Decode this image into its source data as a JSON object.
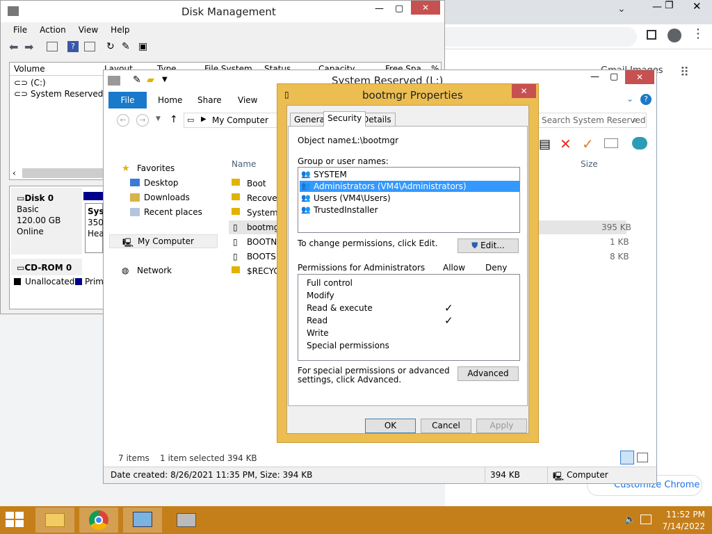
{
  "chrome": {
    "customize_label": "Customize Chrome",
    "partial_text": "Gmail   Images"
  },
  "disk_mgmt": {
    "title": "Disk Management",
    "menu": [
      "File",
      "Action",
      "View",
      "Help"
    ],
    "columns": [
      "Volume",
      "Layout",
      "Type",
      "File System",
      "Status",
      "Capacity",
      "Free Spa",
      "%"
    ],
    "volumes": [
      "(C:)",
      "System Reserved (..."
    ],
    "disk0": {
      "name": "Disk 0",
      "type": "Basic",
      "size": "120.00 GB",
      "status": "Online"
    },
    "disk0_partition": {
      "name": "Syst",
      "size": "350",
      "status": "Hea"
    },
    "cdrom": "CD-ROM 0",
    "legend": {
      "unallocated": "Unallocated",
      "primary": "Prima"
    }
  },
  "explorer": {
    "title": "System Reserved (L:)",
    "tabs": [
      "File",
      "Home",
      "Share",
      "View"
    ],
    "breadcrumb": "My Computer",
    "search_placeholder": "Search System Reserved (L:)",
    "nav": {
      "favorites": "Favorites",
      "fav_items": [
        "Desktop",
        "Downloads",
        "Recent places"
      ],
      "computer": "My Computer",
      "network": "Network"
    },
    "col_name": "Name",
    "col_size": "Size",
    "files": [
      "Boot",
      "Recovery",
      "System V",
      "bootmgr",
      "BOOTNX",
      "BOOTSE",
      "$RECYC"
    ],
    "sizes": [
      "395 KB",
      "1 KB",
      "8 KB"
    ],
    "status_items": "7 items",
    "status_selected": "1 item selected  394 KB",
    "detail_info": "Date created: 8/26/2021 11:35 PM, Size: 394 KB",
    "detail_size": "394 KB",
    "detail_location": "Computer"
  },
  "props": {
    "title": "bootmgr Properties",
    "tabs": [
      "General",
      "Security",
      "Details"
    ],
    "object_label": "Object name:",
    "object_value": "L:\\bootmgr",
    "group_label": "Group or user names:",
    "users": [
      "SYSTEM",
      "Administrators (VM4\\Administrators)",
      "Users (VM4\\Users)",
      "TrustedInstaller"
    ],
    "change_text": "To change permissions, click Edit.",
    "edit_label": "Edit...",
    "perm_label": "Permissions for Administrators",
    "allow_label": "Allow",
    "deny_label": "Deny",
    "permissions": [
      "Full control",
      "Modify",
      "Read & execute",
      "Read",
      "Write",
      "Special permissions"
    ],
    "allowed": [
      false,
      false,
      true,
      true,
      false,
      false
    ],
    "special_text": "For special permissions or advanced settings, click Advanced.",
    "advanced_label": "Advanced",
    "ok_label": "OK",
    "cancel_label": "Cancel",
    "apply_label": "Apply"
  },
  "taskbar": {
    "time": "11:52 PM",
    "date": "7/14/2022"
  }
}
